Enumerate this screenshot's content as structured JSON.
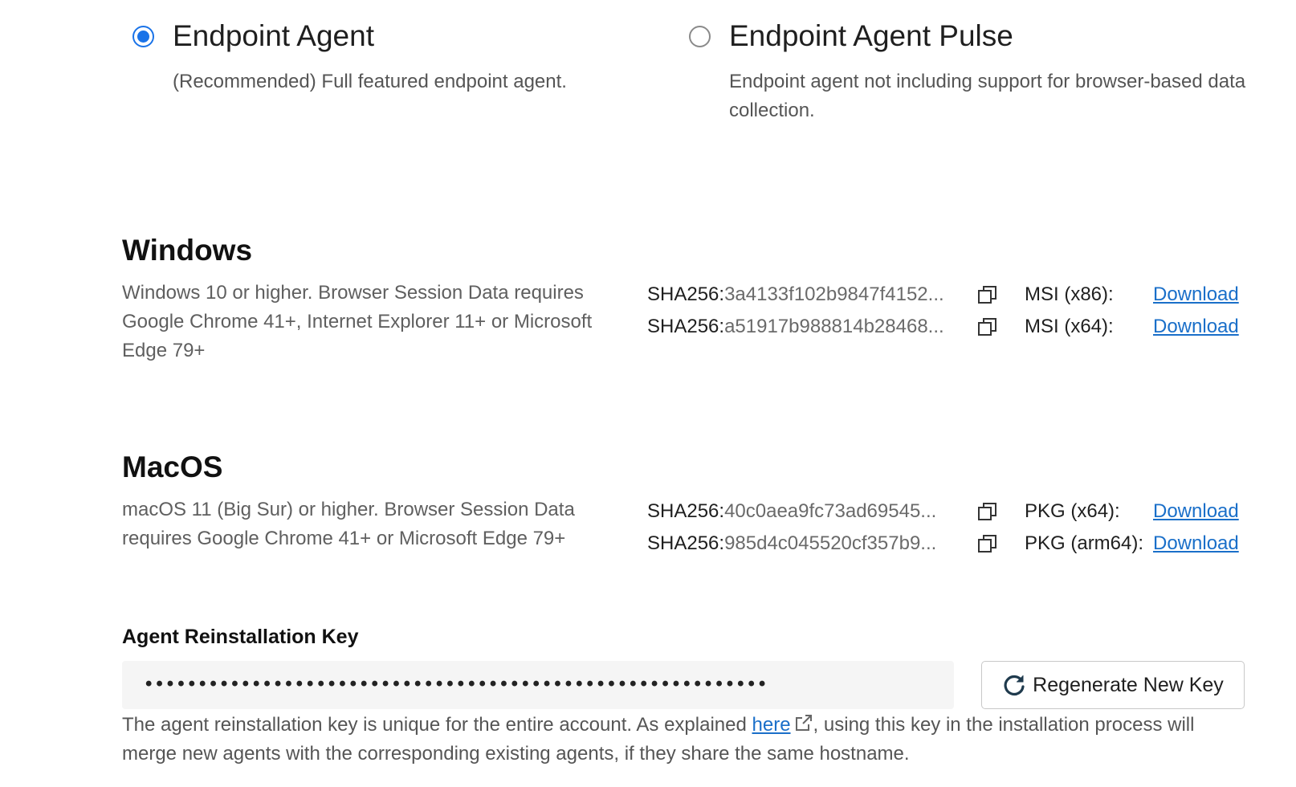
{
  "agent_types": [
    {
      "label": "Endpoint Agent",
      "description": "(Recommended) Full featured endpoint agent.",
      "selected": true
    },
    {
      "label": "Endpoint Agent Pulse",
      "description": "Endpoint agent not including support for browser-based data collection.",
      "selected": false
    }
  ],
  "windows": {
    "title": "Windows",
    "description": "Windows 10 or higher. Browser Session Data requires Google Chrome 41+, Internet Explorer 11+ or Microsoft Edge 79+",
    "hashes": [
      {
        "prefix": "SHA256:",
        "value": "3a4133f102b9847f4152..."
      },
      {
        "prefix": "SHA256:",
        "value": "a51917b988814b28468..."
      }
    ],
    "packages": [
      {
        "label": "MSI (x86):",
        "link": "Download"
      },
      {
        "label": "MSI (x64):",
        "link": "Download"
      }
    ]
  },
  "macos": {
    "title": "MacOS",
    "description": "macOS 11 (Big Sur) or higher. Browser Session Data requires Google Chrome 41+ or Microsoft Edge 79+",
    "hashes": [
      {
        "prefix": "SHA256:",
        "value": "40c0aea9fc73ad69545..."
      },
      {
        "prefix": "SHA256:",
        "value": "985d4c045520cf357b9..."
      }
    ],
    "packages": [
      {
        "label": "PKG (x64):",
        "link": "Download"
      },
      {
        "label": "PKG (arm64):",
        "link": "Download"
      }
    ]
  },
  "reinstall_key": {
    "heading": "Agent Reinstallation Key",
    "masked_value": "••••••••••••••••••••••••••••••••••••••••••••••••••••••••••",
    "regenerate_label": "Regenerate New Key",
    "note_before": "The agent reinstallation key is unique for the entire account. As explained ",
    "note_link": "here",
    "note_after": ", using this key in the installation process will merge new agents with the corresponding existing agents, if they share the same hostname."
  },
  "icons": {
    "copy": "copy-icon",
    "refresh": "refresh-icon",
    "external_link": "external-link-icon"
  },
  "colors": {
    "accent": "#1a73e8",
    "link": "#1a6fc9"
  }
}
